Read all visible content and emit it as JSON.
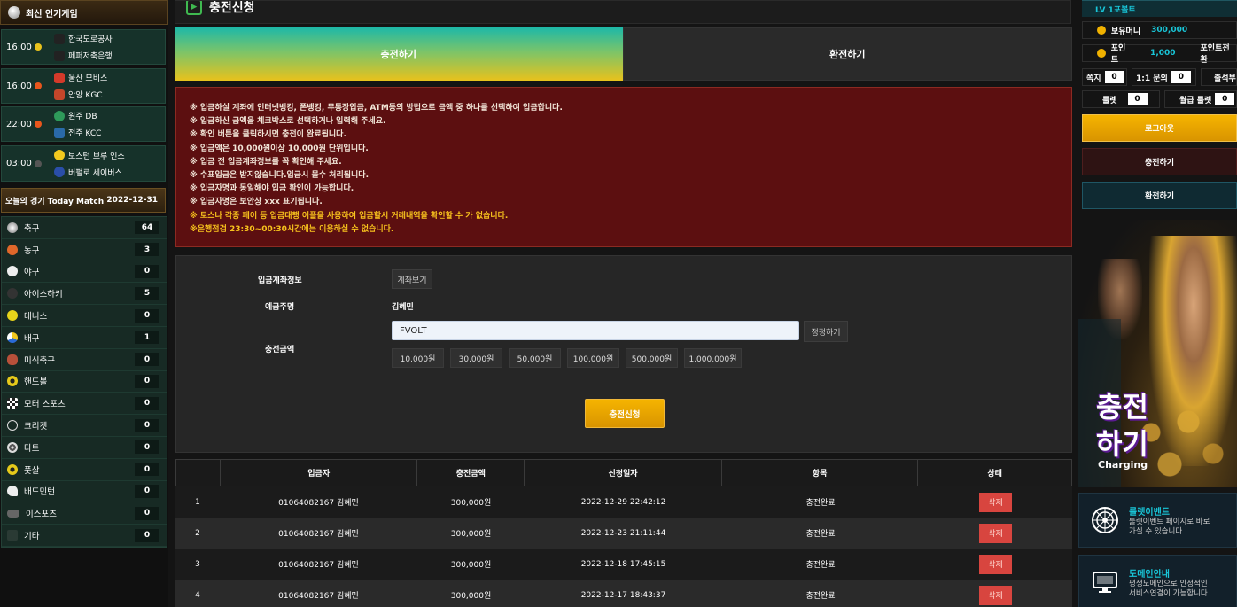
{
  "left": {
    "popular_title": "최신 인기게임",
    "games": [
      {
        "time": "16:00",
        "home": "한국도로공사",
        "away": "페퍼저축은행",
        "dot": "#e8c21c"
      },
      {
        "time": "16:00",
        "home": "울산 모비스",
        "away": "안양 KGC",
        "dot": "#e8561c"
      },
      {
        "time": "22:00",
        "home": "원주 DB",
        "away": "전주 KCC",
        "dot": "#e8561c"
      },
      {
        "time": "03:00",
        "home": "보스턴 브루 인스",
        "away": "버펄로 세이버스",
        "dot": "#555555"
      }
    ],
    "today_label": "오늘의 경기 Today Match",
    "today_date": "2022-12-31",
    "sports": [
      {
        "name": "축구",
        "count": "64"
      },
      {
        "name": "농구",
        "count": "3"
      },
      {
        "name": "야구",
        "count": "0"
      },
      {
        "name": "아이스하키",
        "count": "5"
      },
      {
        "name": "테니스",
        "count": "0"
      },
      {
        "name": "배구",
        "count": "1"
      },
      {
        "name": "미식축구",
        "count": "0"
      },
      {
        "name": "핸드볼",
        "count": "0"
      },
      {
        "name": "모터 스포츠",
        "count": "0"
      },
      {
        "name": "크리켓",
        "count": "0"
      },
      {
        "name": "다트",
        "count": "0"
      },
      {
        "name": "풋살",
        "count": "0"
      },
      {
        "name": "배드민턴",
        "count": "0"
      },
      {
        "name": "이스포츠",
        "count": "0"
      },
      {
        "name": "기타",
        "count": "0"
      }
    ]
  },
  "main": {
    "title": "충전신청",
    "tabs": {
      "charge": "충전하기",
      "exchange": "환전하기"
    },
    "notices": [
      "※ 입금하실 계좌에 인터넷뱅킹, 폰뱅킹, 무통장입금, ATM등의 방법으로 금액 중 하나를 선택하여 입금합니다.",
      "※ 입금하신 금액을 체크박스로 선택하거나 입력해 주세요.",
      "※ 확인 버튼을 클릭하시면 충전이 완료됩니다.",
      "※ 입금액은 10,000원이상 10,000원 단위입니다.",
      "※ 입금 전 입금계좌정보를 꼭 확인해 주세요.",
      "※ 수표입금은 받지않습니다.입금시 몰수 처리됩니다.",
      "※ 입금자명과 동일해야 입금 확인이 가능합니다.",
      "※ 입금자명은 보안상 xxx 표기됩니다."
    ],
    "notices_yellow": [
      "※ 토스나 각종 페이 등 입금대행 어플을 사용하여 입금할시 거래내역을 확인할 수 가 없습니다.",
      "※은행점검 23:30~00:30시간에는 이용하실 수 없습니다."
    ],
    "form": {
      "account_label": "입금계좌정보",
      "account_button": "계좌보기",
      "depositor_label": "예금주명",
      "depositor_value": "김혜민",
      "amount_label": "충전금액",
      "amount_value": "FVOLT",
      "reset_button": "정정하기",
      "amounts": [
        "10,000원",
        "30,000원",
        "50,000원",
        "100,000원",
        "500,000원",
        "1,000,000원"
      ],
      "submit": "충전신청"
    },
    "table": {
      "headers": [
        "",
        "입금자",
        "충전금액",
        "신청일자",
        "항목",
        "상태"
      ],
      "rows": [
        {
          "no": "1",
          "name": "01064082167 김혜민",
          "amount": "300,000원",
          "date": "2022-12-29 22:42:12",
          "item": "충전완료",
          "action": "삭제"
        },
        {
          "no": "2",
          "name": "01064082167 김혜민",
          "amount": "300,000원",
          "date": "2022-12-23 21:11:44",
          "item": "충전완료",
          "action": "삭제"
        },
        {
          "no": "3",
          "name": "01064082167 김혜민",
          "amount": "300,000원",
          "date": "2022-12-18 17:45:15",
          "item": "충전완료",
          "action": "삭제"
        },
        {
          "no": "4",
          "name": "01064082167 김혜민",
          "amount": "300,000원",
          "date": "2022-12-17 18:43:37",
          "item": "충전완료",
          "action": "삭제"
        }
      ]
    }
  },
  "right": {
    "level": "LV 1포볼트",
    "money_label": "보유머니",
    "money_value": "300,000",
    "point_label": "포인트",
    "point_value": "1,000",
    "point_convert": "포인트전환",
    "note_label": "쪽지",
    "note_count": "0",
    "inquiry_label": "1:1 문의",
    "inquiry_count": "0",
    "attend_label": "출석부",
    "roulette_label": "룰렛",
    "roulette_count": "0",
    "monthly_roulette_label": "월급 룰렛",
    "monthly_roulette_count": "0",
    "logout": "로그아웃",
    "charge": "충전하기",
    "exchange": "환전하기",
    "banner_line1": "충전",
    "banner_line2": "하기",
    "banner_sub": "Charging",
    "promo1_title": "룰렛이벤트",
    "promo1_desc1": "룰렛이벤트 페이지로 바로",
    "promo1_desc2": "가실 수 있습니다",
    "promo2_title": "도메인안내",
    "promo2_desc1": "평생도메인으로 안정적인",
    "promo2_desc2": "서비스연결이 가능합니다"
  }
}
